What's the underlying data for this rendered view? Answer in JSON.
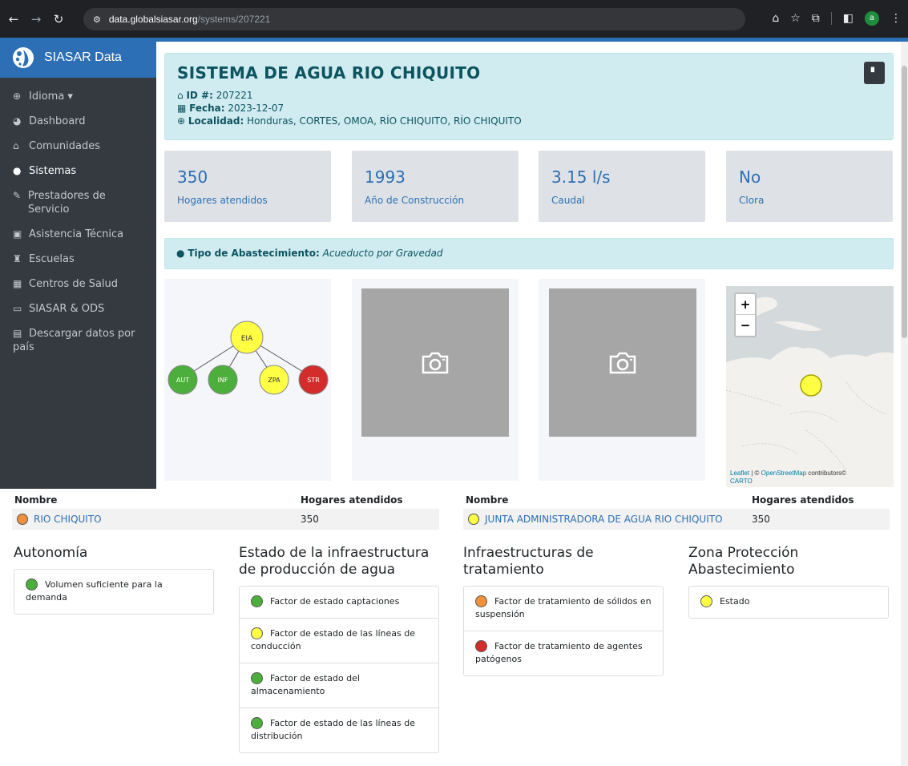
{
  "browser": {
    "url_host": "data.globalsiasar.org",
    "url_path": "/systems/207221",
    "avatar_letter": "a"
  },
  "sidebar": {
    "brand": "SIASAR Data",
    "items": [
      {
        "label": "Idioma ▾",
        "icon": "globe-icon"
      },
      {
        "label": "Dashboard",
        "icon": "dashboard-icon"
      },
      {
        "label": "Comunidades",
        "icon": "home-icon"
      },
      {
        "label": "Sistemas",
        "icon": "water-drop-icon"
      },
      {
        "label": "Prestadores de Servicio",
        "icon": "wrench-icon"
      },
      {
        "label": "Asistencia Técnica",
        "icon": "clipboard-icon"
      },
      {
        "label": "Escuelas",
        "icon": "school-icon"
      },
      {
        "label": "Centros de Salud",
        "icon": "hospital-icon"
      },
      {
        "label": "SIASAR & ODS",
        "icon": "monitor-icon"
      },
      {
        "label": "Descargar datos por país",
        "icon": "excel-icon"
      }
    ]
  },
  "header": {
    "title": "SISTEMA DE AGUA RIO CHIQUITO",
    "id_label": "ID #:",
    "id_value": "207221",
    "fecha_label": "Fecha:",
    "fecha_value": "2023-12-07",
    "localidad_label": "Localidad:",
    "localidad_value": "Honduras, CORTES, OMOA, RÍO CHIQUITO, RÍO CHIQUITO"
  },
  "stats": [
    {
      "value": "350",
      "label": "Hogares atendidos"
    },
    {
      "value": "1993",
      "label": "Año de Construcción"
    },
    {
      "value": "3.15 l/s",
      "label": "Caudal"
    },
    {
      "value": "No",
      "label": "Clora"
    }
  ],
  "tipo": {
    "label": "Tipo de Abastecimiento:",
    "value": "Acueducto por Gravedad"
  },
  "tree": {
    "root": "EIA",
    "children": [
      "AUT",
      "INF",
      "ZPA",
      "STR"
    ]
  },
  "map": {
    "zoom_in": "+",
    "zoom_out": "−",
    "attribution_leaflet": "Leaflet",
    "attribution_sep": " | © ",
    "attribution_osm": "OpenStreetMap",
    "attribution_rest": " contributors©",
    "attribution_carto": "CARTO"
  },
  "table_left": {
    "col_name": "Nombre",
    "col_hogares": "Hogares atendidos",
    "row_name": "RIO CHIQUITO",
    "row_hogares": "350",
    "row_color": "#f0903a"
  },
  "table_right": {
    "col_name": "Nombre",
    "col_hogares": "Hogares atendidos",
    "row_name": "JUNTA ADMINISTRADORA DE AGUA RIO CHIQUITO",
    "row_hogares": "350",
    "row_color": "#ffff44"
  },
  "indicators": {
    "autonomia": {
      "title": "Autonomía",
      "items": [
        "Volumen suficiente para la demanda"
      ]
    },
    "infraestructura": {
      "title": "Estado de la infraestructura de producción de agua",
      "items": [
        "Factor de estado captaciones",
        "Factor de estado de las líneas de conducción",
        "Factor de estado del almacenamiento",
        "Factor de estado de las líneas de distribución"
      ]
    },
    "tratamiento": {
      "title": "Infraestructuras de tratamiento",
      "items": [
        "Factor de tratamiento de sólidos en suspensión",
        "Factor de tratamiento de agentes patógenos"
      ]
    },
    "zona": {
      "title": "Zona Protección Abastecimiento",
      "items": [
        "Estado"
      ]
    }
  },
  "colors": {
    "green": "#4caf3c",
    "yellow": "#ffff44",
    "orange": "#f0903a",
    "red": "#d42b2b",
    "brand_blue": "#2c6fb5"
  }
}
